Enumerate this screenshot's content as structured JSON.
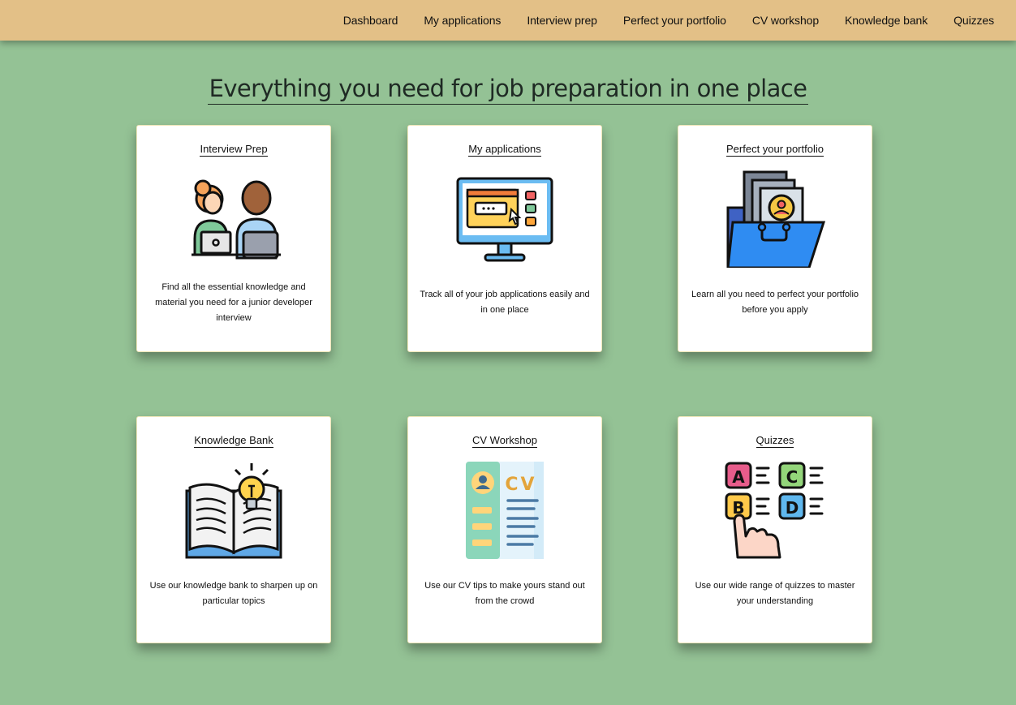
{
  "nav": {
    "items": [
      "Dashboard",
      "My applications",
      "Interview prep",
      "Perfect your portfolio",
      "CV workshop",
      "Knowledge bank",
      "Quizzes"
    ]
  },
  "headline": "Everything you need for job preparation in one place",
  "cards": [
    {
      "title": "Interview Prep",
      "description": "Find all the essential knowledge and material you need for a junior developer interview",
      "icon": "interview-icon"
    },
    {
      "title": "My applications",
      "description": "Track all of your job applications easily and in one place",
      "icon": "monitor-icon"
    },
    {
      "title": "Perfect your portfolio",
      "description": "Learn all you need to perfect your portfolio before you apply",
      "icon": "portfolio-folder-icon"
    },
    {
      "title": "Knowledge Bank",
      "description": "Use our knowledge bank to sharpen up on particular topics",
      "icon": "book-bulb-icon"
    },
    {
      "title": "CV Workshop",
      "description": "Use our CV tips to make yours stand out from the crowd",
      "icon": "cv-document-icon"
    },
    {
      "title": "Quizzes",
      "description": "Use our wide range of quizzes to master your understanding",
      "icon": "quiz-icon"
    }
  ],
  "colors": {
    "page_background": "#94c295",
    "topbar": "#e3c087",
    "card": "#ffffff"
  },
  "cv_icon_text": "CV",
  "quiz_letters": [
    "A",
    "B",
    "C",
    "D"
  ]
}
